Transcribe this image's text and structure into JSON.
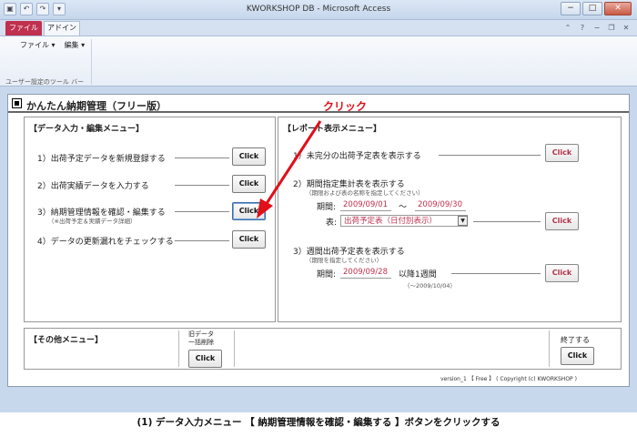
{
  "window": {
    "title": "KWORKSHOP DB - Microsoft Access",
    "qat_icons": [
      "save-icon",
      "undo-icon",
      "redo-icon",
      "customize-icon"
    ],
    "controls": {
      "minimize": "−",
      "maximize": "□",
      "close": "✕"
    }
  },
  "ribbon": {
    "tabs": [
      "ファイル",
      "アドイン"
    ],
    "menus": [
      "ファイル ▾",
      "編集 ▾"
    ],
    "group_label": "ユーザー設定のツール バー"
  },
  "form": {
    "title": "かんたん納期管理（フリー版）",
    "data_section": {
      "title": "【データ入力・編集メニュー】",
      "rows": [
        {
          "label": "1）出荷予定データを新規登録する",
          "button": "Click"
        },
        {
          "label": "2）出荷実績データを入力する",
          "button": "Click"
        },
        {
          "label": "3）納期管理情報を確認・編集する",
          "note": "（※出荷予定＆実績データ詳細）",
          "button": "Click"
        },
        {
          "label": "4）データの更新漏れをチェックする",
          "button": "Click"
        }
      ]
    },
    "report_section": {
      "title": "【レポート表示メニュー】",
      "row1": {
        "label": "1）未完分の出荷予定表を表示する",
        "button": "Click"
      },
      "row2": {
        "label": "2）期間指定集計表を表示する",
        "note": "（期限および表の名称を指定してください）",
        "period_label": "期間:",
        "date_from": "2009/09/01",
        "tilde": "〜",
        "date_to": "2009/09/30",
        "table_label": "表:",
        "table_value": "出荷予定表（日付別表示）",
        "button": "Click"
      },
      "row3": {
        "label": "3）週間出荷予定表を表示する",
        "note": "（期限を指定してください）",
        "period_label": "期間:",
        "date_from": "2009/09/28",
        "suffix": "以降1週間",
        "range_note": "（〜2009/10/04）",
        "button": "Click"
      }
    },
    "other_section": {
      "title": "【その他メニュー】",
      "old_data_label": "旧データ\n一括削除",
      "old_data_button": "Click",
      "exit_label": "終了する",
      "exit_button": "Click"
    },
    "version": "version_1 【 Free 】 ( Copyright (c) KWORKSHOP )"
  },
  "annotation": {
    "label": "クリック",
    "color": "#e0101a"
  },
  "caption": "(1) データ入力メニュー 【 納期管理情報を確認・編集する 】ボタンをクリックする"
}
